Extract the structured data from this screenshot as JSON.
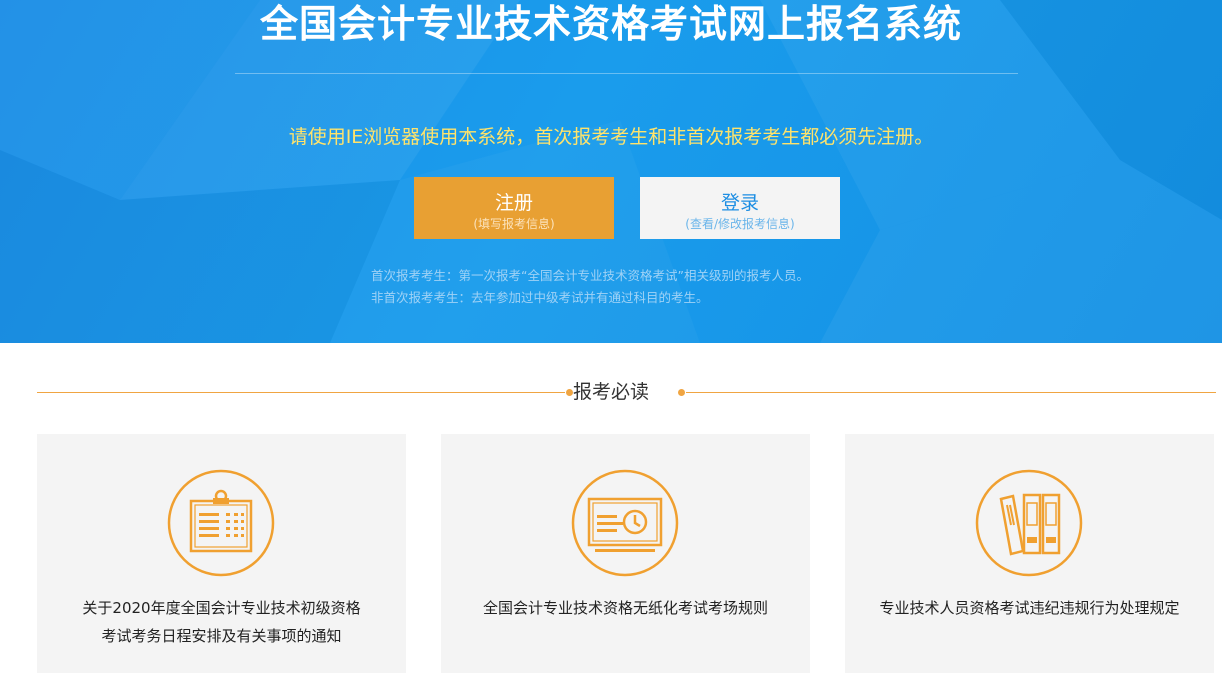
{
  "hero": {
    "title": "全国会计专业技术资格考试网上报名系统",
    "notice": "请使用IE浏览器使用本系统，首次报考考生和非首次报考考生都必须先注册。",
    "register_button": {
      "label": "注册",
      "sublabel": "(填写报考信息)"
    },
    "login_button": {
      "label": "登录",
      "sublabel": "(查看/修改报考信息)"
    },
    "notes": [
      "首次报考考生：第一次报考“全国会计专业技术资格考试”相关级别的报考人员。",
      "非首次报考考生：去年参加过中级考试并有通过科目的考生。"
    ]
  },
  "section": {
    "title": "报考必读"
  },
  "cards": [
    {
      "icon": "calendar-schedule-icon",
      "lines": [
        "关于2020年度全国会计专业技术初级资格",
        "考试考务日程安排及有关事项的通知"
      ]
    },
    {
      "icon": "monitor-clock-icon",
      "lines": [
        "全国会计专业技术资格无纸化考试考场规则"
      ]
    },
    {
      "icon": "binders-icon",
      "lines": [
        "专业技术人员资格考试违纪违规行为处理规定"
      ]
    }
  ],
  "colors": {
    "hero_blue": "#1a9cec",
    "notice_yellow": "#ffe36b",
    "accent_orange": "#e8a033",
    "icon_orange": "#f0a030",
    "card_bg": "#f4f4f4"
  }
}
